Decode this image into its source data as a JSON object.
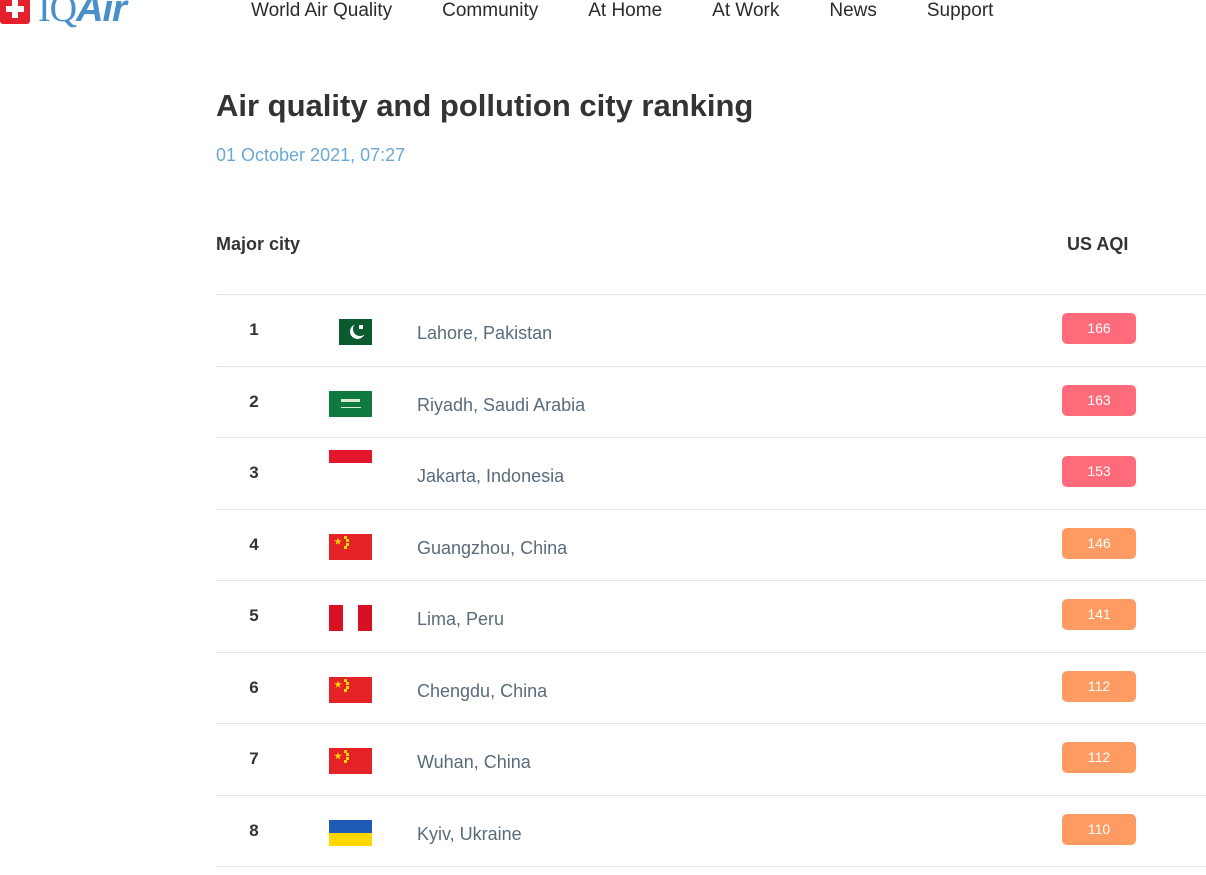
{
  "brand": {
    "logo_text": "IQAir",
    "logo_icon": "swiss-cross-icon"
  },
  "nav": [
    "World Air Quality",
    "Community",
    "At Home",
    "At Work",
    "News",
    "Support"
  ],
  "page": {
    "title": "Air quality and pollution city ranking",
    "date": "01 October 2021, 07:27"
  },
  "table": {
    "headers": {
      "city": "Major city",
      "aqi": "US AQI"
    },
    "rows": [
      {
        "rank": "1",
        "flag": "pakistan-flag-icon",
        "city": "Lahore, Pakistan",
        "aqi": "166",
        "color": "#ff6b7a"
      },
      {
        "rank": "2",
        "flag": "saudi-arabia-flag-icon",
        "city": "Riyadh, Saudi Arabia",
        "aqi": "163",
        "color": "#ff6b7a"
      },
      {
        "rank": "3",
        "flag": "indonesia-flag-icon",
        "city": "Jakarta, Indonesia",
        "aqi": "153",
        "color": "#ff6b7a"
      },
      {
        "rank": "4",
        "flag": "china-flag-icon",
        "city": "Guangzhou, China",
        "aqi": "146",
        "color": "#fd9b63"
      },
      {
        "rank": "5",
        "flag": "peru-flag-icon",
        "city": "Lima, Peru",
        "aqi": "141",
        "color": "#fd9b63"
      },
      {
        "rank": "6",
        "flag": "china-flag-icon",
        "city": "Chengdu, China",
        "aqi": "112",
        "color": "#fd9b63"
      },
      {
        "rank": "7",
        "flag": "china-flag-icon",
        "city": "Wuhan, China",
        "aqi": "112",
        "color": "#fd9b63"
      },
      {
        "rank": "8",
        "flag": "ukraine-flag-icon",
        "city": "Kyiv, Ukraine",
        "aqi": "110",
        "color": "#fd9b63"
      }
    ]
  }
}
